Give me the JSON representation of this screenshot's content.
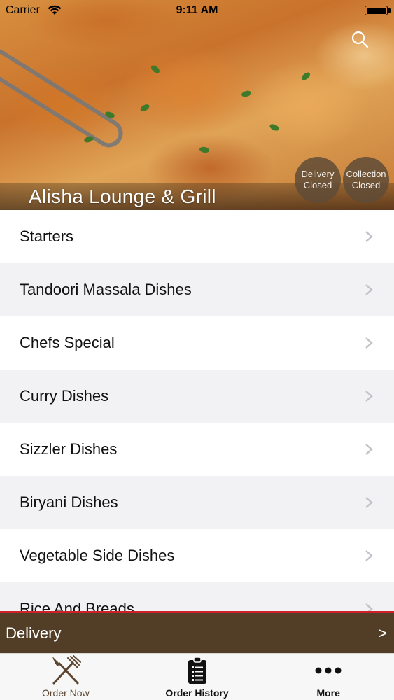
{
  "status_bar": {
    "carrier": "Carrier",
    "time": "9:11 AM"
  },
  "header": {
    "restaurant_name": "Alisha Lounge & Grill",
    "search_icon": "search-icon",
    "badges": {
      "delivery": {
        "line1": "Delivery",
        "line2": "Closed"
      },
      "collection": {
        "line1": "Collection",
        "line2": "Closed"
      }
    }
  },
  "menu": {
    "items": [
      {
        "label": "Starters"
      },
      {
        "label": "Tandoori Massala Dishes"
      },
      {
        "label": "Chefs Special"
      },
      {
        "label": "Curry Dishes"
      },
      {
        "label": "Sizzler Dishes"
      },
      {
        "label": "Biryani Dishes"
      },
      {
        "label": "Vegetable Side Dishes"
      },
      {
        "label": "Rice And Breads"
      }
    ]
  },
  "delivery_bar": {
    "label": "Delivery",
    "arrow": ">"
  },
  "tab_bar": {
    "tabs": [
      {
        "label": "Order Now",
        "icon": "fork-knife-icon",
        "active": true
      },
      {
        "label": "Order History",
        "icon": "clipboard-icon",
        "active": false
      },
      {
        "label": "More",
        "icon": "more-dots-icon",
        "active": false
      }
    ]
  },
  "colors": {
    "delivery_bar_bg": "#523d27",
    "delivery_bar_accent": "#d0202a",
    "active_tab": "#5b4530",
    "badge_bg": "#5f4b37"
  }
}
